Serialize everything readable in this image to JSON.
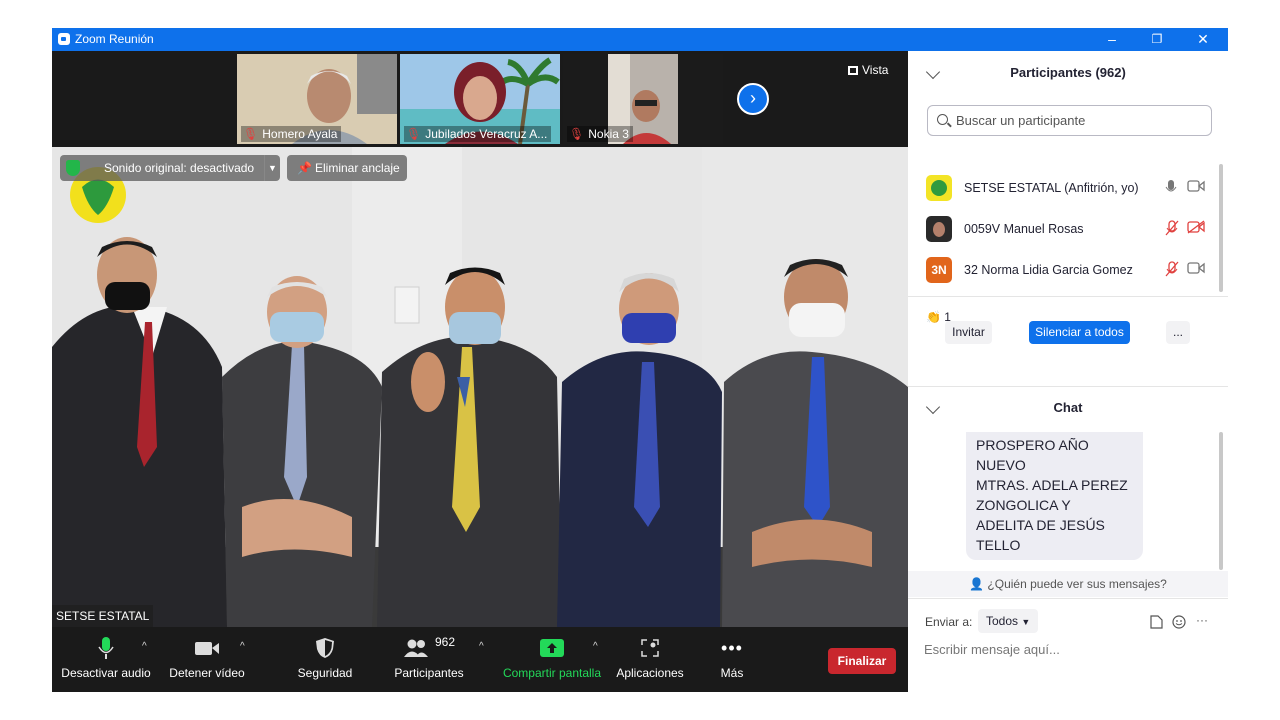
{
  "window": {
    "title": "Zoom Reunión",
    "minimize": "–",
    "restore": "❐",
    "close": "✕"
  },
  "video": {
    "thumbnails": [
      {
        "name": "Homero Ayala",
        "muted": true
      },
      {
        "name": "Jubilados Veracruz A...",
        "muted": true
      },
      {
        "name": "Nokia 3",
        "muted": true
      }
    ],
    "view_label": "Vista",
    "original_sound_label": "Sonido original: desactivado",
    "unpin_label": "Eliminar anclaje",
    "presenter_name": "SETSE ESTATAL"
  },
  "toolbar": {
    "mute_label": "Desactivar audio",
    "video_label": "Detener vídeo",
    "security_label": "Seguridad",
    "participants_label": "Participantes",
    "participants_count": "962",
    "share_label": "Compartir pantalla",
    "apps_label": "Aplicaciones",
    "more_label": "Más",
    "end_label": "Finalizar"
  },
  "participants_panel": {
    "title": "Participantes (962)",
    "search_placeholder": "Buscar un participante",
    "participants": [
      {
        "name": "SETSE ESTATAL (Anfitrión, yo)",
        "mic": "on",
        "camera": "on"
      },
      {
        "name": "0059V Manuel Rosas",
        "mic": "muted",
        "camera": "off"
      },
      {
        "name": "32 Norma Lidia Garcia Gomez",
        "initials": "3N",
        "mic": "muted",
        "camera": "on"
      }
    ],
    "reaction_emoji": "👏",
    "reaction_count": "1",
    "invite_label": "Invitar",
    "mute_all_label": "Silenciar a todos",
    "more_label": "..."
  },
  "chat": {
    "title": "Chat",
    "message_lines": [
      "PROSPERO AÑO",
      "NUEVO",
      "MTRAS. ADELA PEREZ",
      "ZONGOLICA Y",
      "ADELITA DE JESÚS",
      "TELLO"
    ],
    "who_can_see": "¿Quién puede ver sus mensajes?",
    "send_to_label": "Enviar a:",
    "recipient": "Todos",
    "input_placeholder": "Escribir mensaje aquí..."
  },
  "colors": {
    "zoom_blue": "#0e71eb",
    "end_red": "#c9272e",
    "share_green": "#23d959",
    "muted_red": "#e0413f"
  }
}
